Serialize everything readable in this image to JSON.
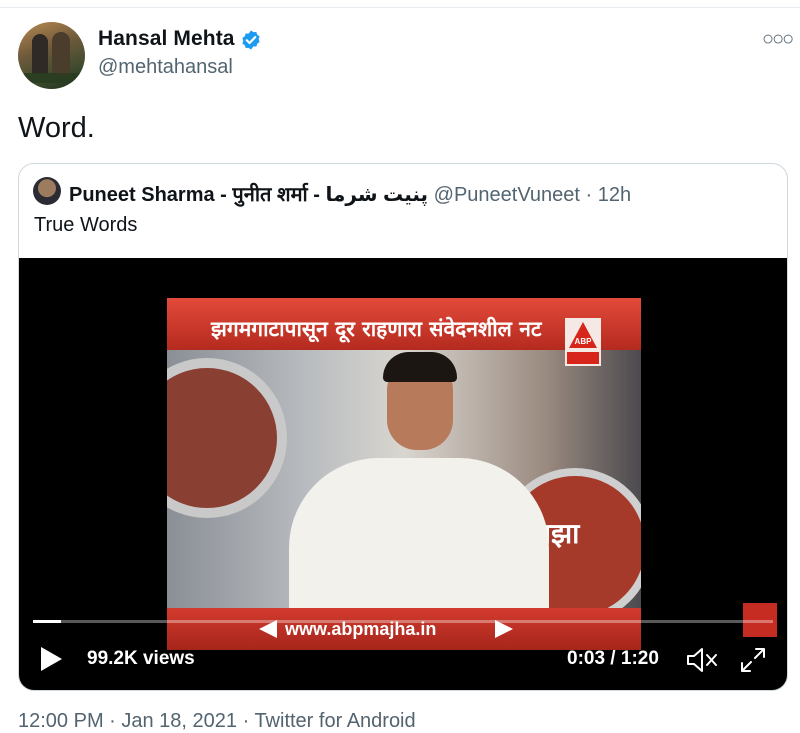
{
  "tweet": {
    "author": {
      "name": "Hansal Mehta",
      "handle": "@mehtahansal",
      "verified": true
    },
    "text": "Word.",
    "more_icon": "more-dots-icon",
    "footer": "12:00 PM · Jan 18, 2021 · Twitter for Android"
  },
  "quote": {
    "name": "Puneet Sharma - पुनीत शर्मा - پنیت شرما",
    "handle": "@PuneetVuneet",
    "separator": " · ",
    "time": "12h",
    "text": "True Words"
  },
  "video": {
    "banner_text": "झगमगाटापासून दूर राहणारा संवेदनशील नट",
    "logo_text": "ABP",
    "circle_text": "माझा",
    "url": "www.abpmajha.in",
    "views": "99.2K views",
    "current_time": "0:03",
    "duration": "1:20",
    "time_separator": " / ",
    "progress": 0.0375
  },
  "colors": {
    "accent": "#1d9bf0",
    "secondary_text": "#536471",
    "border": "#cfd9de",
    "banner_red": "#c72c22"
  }
}
